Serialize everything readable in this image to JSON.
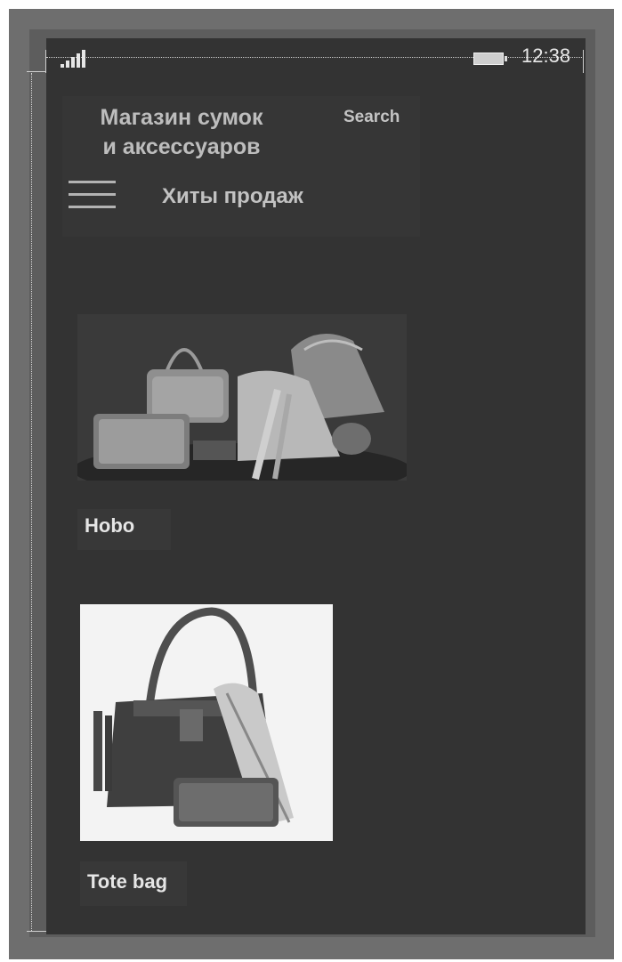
{
  "status_bar": {
    "time": "12:38",
    "signal_icon": "signal-bars-icon",
    "battery_icon": "battery-icon"
  },
  "header": {
    "store_title_line1": "Магазин сумок",
    "store_title_line2": "и аксессуаров",
    "search_label": "Search",
    "menu_icon": "hamburger-menu-icon",
    "section_title": "Хиты продаж"
  },
  "products": [
    {
      "name": "Hobo",
      "image": "bags-collection-photo"
    },
    {
      "name": "Tote bag",
      "image": "tote-bag-photo"
    }
  ],
  "colors": {
    "screen_bg": "#333333",
    "frame": "#6e6e6e",
    "text_light": "#e6e6e6"
  }
}
